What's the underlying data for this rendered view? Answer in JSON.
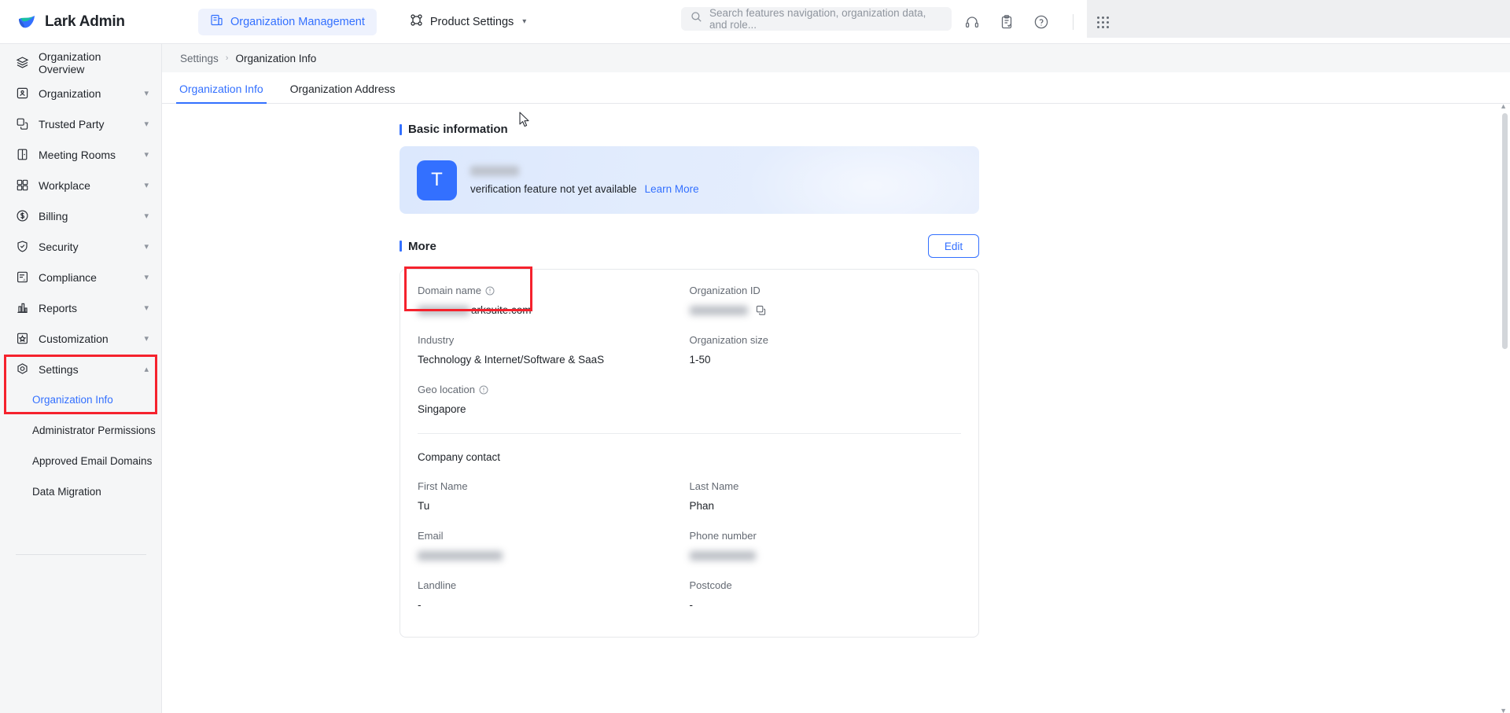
{
  "header": {
    "brand": "Lark Admin",
    "nav": [
      {
        "label": "Organization Management",
        "icon": "building-icon",
        "active": true
      },
      {
        "label": "Product Settings",
        "icon": "product-icon",
        "active": false
      }
    ],
    "search_placeholder": "Search features navigation, organization data, and role...",
    "icons": [
      "headset-icon",
      "clipboard-check-icon",
      "help-circle-icon",
      "apps-grid-icon"
    ]
  },
  "sidebar": {
    "items": [
      {
        "label": "Organization Overview",
        "icon": "layers-icon",
        "expandable": false
      },
      {
        "label": "Organization",
        "icon": "contact-card-icon",
        "expandable": true
      },
      {
        "label": "Trusted Party",
        "icon": "copy-squares-icon",
        "expandable": true
      },
      {
        "label": "Meeting Rooms",
        "icon": "door-icon",
        "expandable": true
      },
      {
        "label": "Workplace",
        "icon": "grid-squares-icon",
        "expandable": true
      },
      {
        "label": "Billing",
        "icon": "dollar-circle-icon",
        "expandable": true
      },
      {
        "label": "Security",
        "icon": "shield-check-icon",
        "expandable": true
      },
      {
        "label": "Compliance",
        "icon": "document-a-icon",
        "expandable": true
      },
      {
        "label": "Reports",
        "icon": "bar-chart-icon",
        "expandable": true
      },
      {
        "label": "Customization",
        "icon": "star-box-icon",
        "expandable": true
      },
      {
        "label": "Settings",
        "icon": "gear-hex-icon",
        "expandable": true,
        "expanded": true
      }
    ],
    "settings_children": [
      {
        "label": "Organization Info",
        "selected": true
      },
      {
        "label": "Administrator Permissions",
        "selected": false
      },
      {
        "label": "Approved Email Domains",
        "selected": false
      },
      {
        "label": "Data Migration",
        "selected": false
      }
    ]
  },
  "breadcrumb": {
    "parent": "Settings",
    "separator": "›",
    "current": "Organization Info"
  },
  "tabs": [
    {
      "label": "Organization Info",
      "active": true
    },
    {
      "label": "Organization Address",
      "active": false
    }
  ],
  "basic": {
    "section_title": "Basic information",
    "avatar_letter": "T",
    "org_name_redacted": true,
    "notice": "verification feature not yet available",
    "learn_more": "Learn More"
  },
  "more": {
    "section_title": "More",
    "edit_label": "Edit",
    "fields": [
      {
        "label": "Domain name",
        "info": true,
        "value": "arksuite.com",
        "redacted_prefix": true
      },
      {
        "label": "Organization ID",
        "info": false,
        "value": "",
        "redacted": true,
        "copy": true
      },
      {
        "label": "Industry",
        "info": false,
        "value": "Technology & Internet/Software & SaaS"
      },
      {
        "label": "Organization size",
        "info": false,
        "value": "1-50"
      },
      {
        "label": "Geo location",
        "info": true,
        "value": "Singapore"
      }
    ],
    "contact_title": "Company contact",
    "contact_fields": [
      {
        "label": "First Name",
        "value": "Tu"
      },
      {
        "label": "Last Name",
        "value": "Phan"
      },
      {
        "label": "Email",
        "value": "",
        "redacted": true
      },
      {
        "label": "Phone number",
        "value": "",
        "redacted": true
      },
      {
        "label": "Landline",
        "value": "-"
      },
      {
        "label": "Postcode",
        "value": "-"
      }
    ]
  },
  "colors": {
    "accent": "#3370ff",
    "annotation": "#f5222d",
    "sidebar_bg": "#f5f6f7",
    "banner_start": "#dce8fd"
  }
}
